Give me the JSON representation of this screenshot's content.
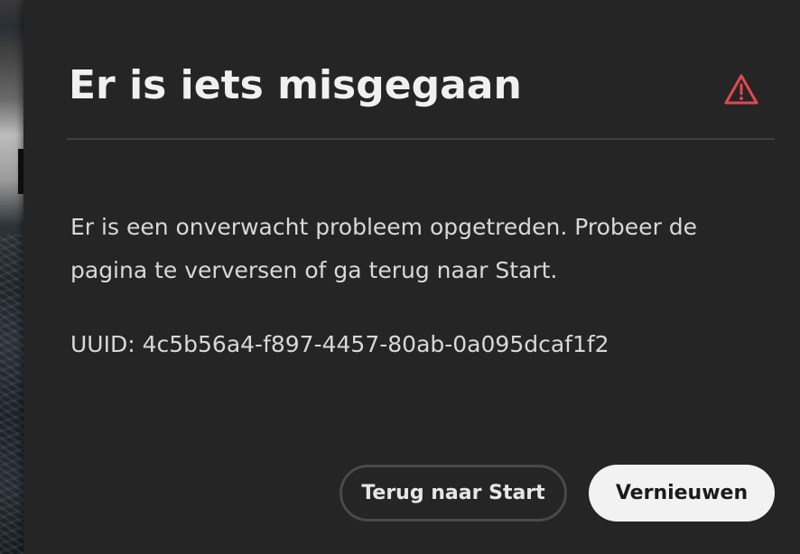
{
  "dialog": {
    "title": "Er is iets misgegaan",
    "alert_icon": "alert-triangle-icon",
    "alert_color": "#e34850",
    "message": "Er is een onverwacht probleem opgetreden. Probeer de pagina te verversen of ga terug naar Start.",
    "uuid_text": "UUID: 4c5b56a4-f897-4457-80ab-0a095dcaf1f2",
    "buttons": {
      "secondary_label": "Terug naar Start",
      "primary_label": "Vernieuwen"
    }
  }
}
